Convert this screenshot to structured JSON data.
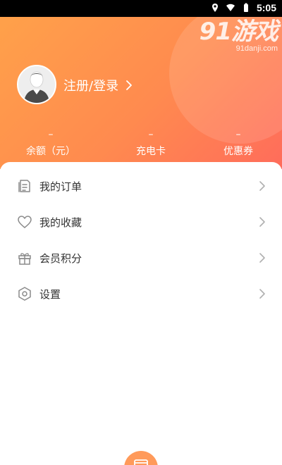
{
  "status_bar": {
    "time": "5:05"
  },
  "watermark": {
    "big": "91游戏",
    "small": "91danji.com"
  },
  "profile": {
    "login_label": "注册/登录"
  },
  "stats": [
    {
      "value": "–",
      "label": "余额（元）"
    },
    {
      "value": "–",
      "label": "充电卡"
    },
    {
      "value": "–",
      "label": "优惠券"
    }
  ],
  "menu": [
    {
      "label": "我的订单",
      "icon": "orders-icon"
    },
    {
      "label": "我的收藏",
      "icon": "heart-icon"
    },
    {
      "label": "会员积分",
      "icon": "gift-icon"
    },
    {
      "label": "设置",
      "icon": "settings-icon"
    }
  ],
  "colors": {
    "header_start": "#ffa14a",
    "header_end": "#ff6c5b",
    "accent": "#ff9a5a"
  }
}
